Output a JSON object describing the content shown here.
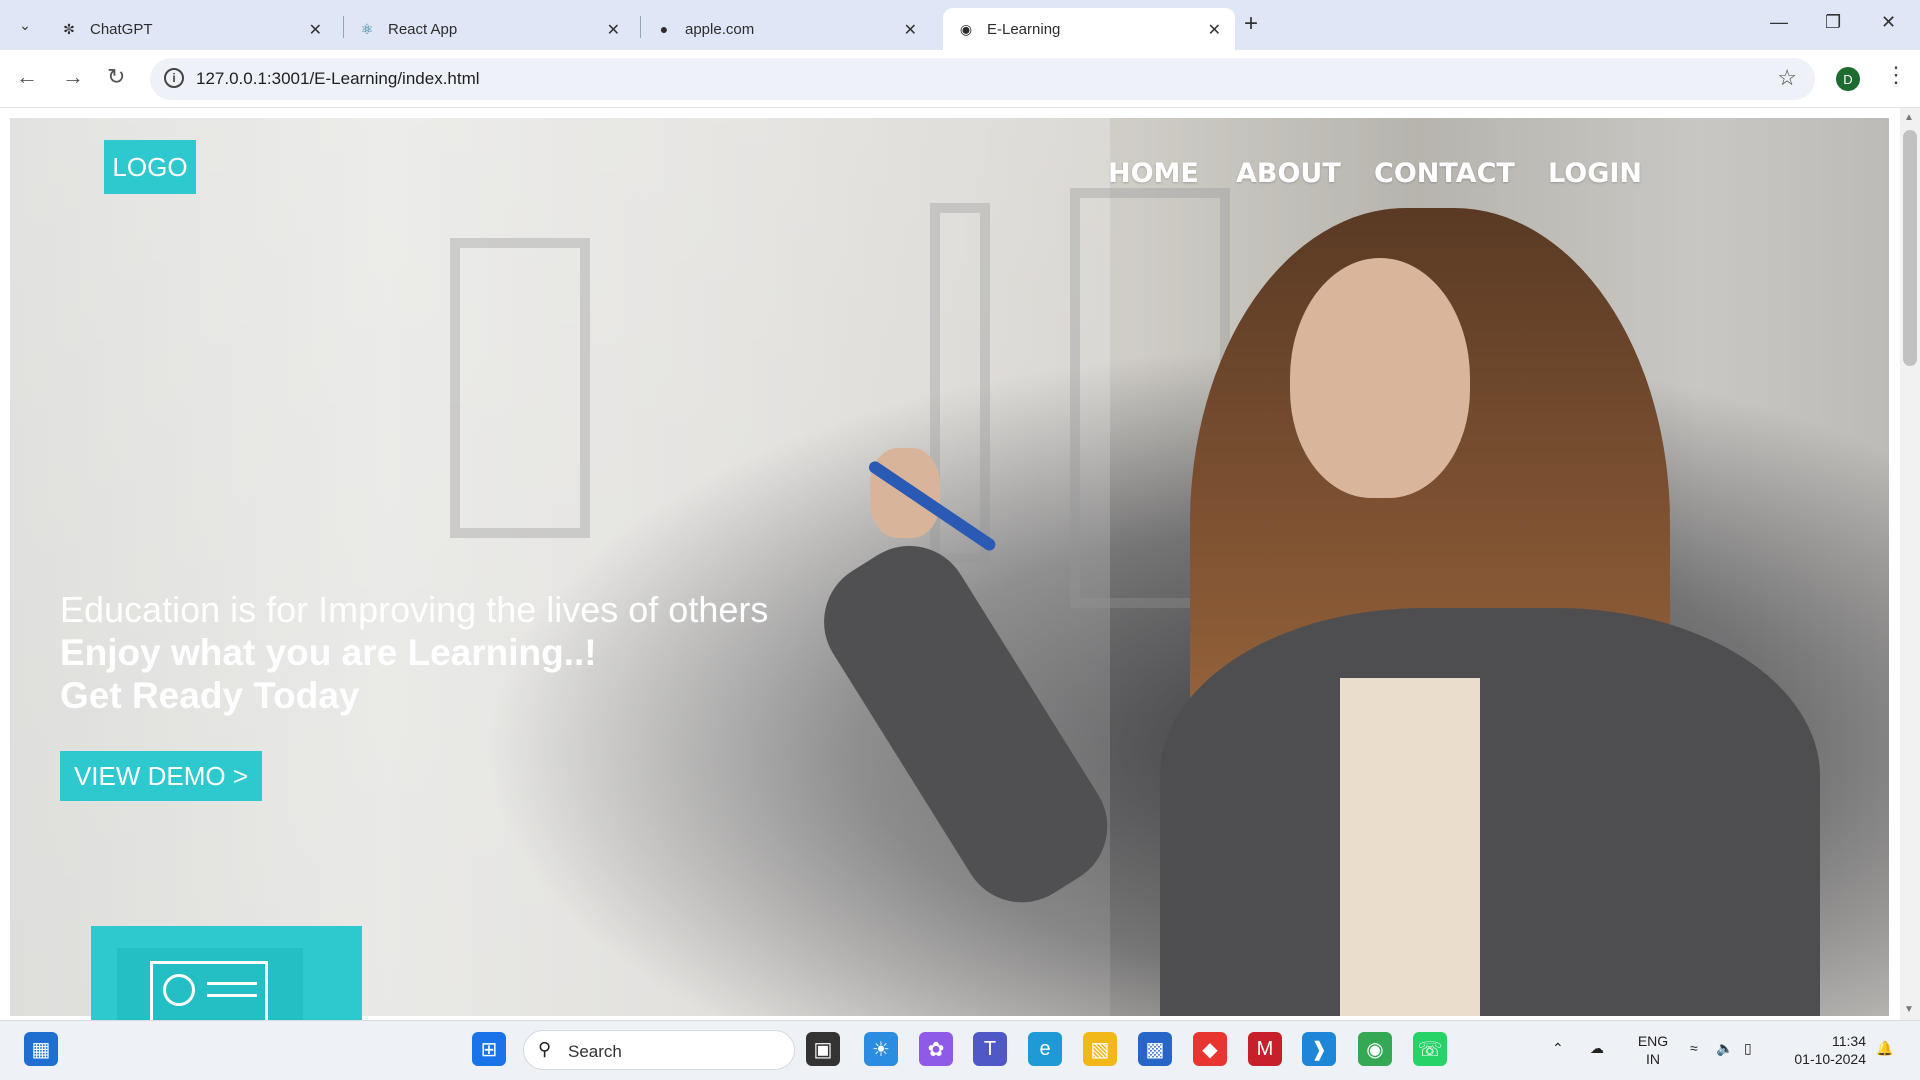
{
  "browser": {
    "tabs": [
      {
        "title": "ChatGPT",
        "icon": "chatgpt-icon"
      },
      {
        "title": "React App",
        "icon": "react-icon"
      },
      {
        "title": "apple.com",
        "icon": "apple-icon"
      },
      {
        "title": "E-Learning",
        "icon": "globe-icon",
        "active": true
      }
    ],
    "url": "127.0.0.1:3001/E-Learning/index.html",
    "profile_initial": "D"
  },
  "page": {
    "logo": "LOGO",
    "nav": [
      "HOME",
      "ABOUT",
      "CONTACT",
      "LOGIN"
    ],
    "hero": {
      "line1": "Education is for Improving the lives of others",
      "line2": "Enjoy what you are Learning..!",
      "line3": "Get Ready Today"
    },
    "cta": "VIEW DEMO >",
    "accent_color": "#2ec9cf"
  },
  "taskbar": {
    "search_label": "Search",
    "lang_top": "ENG",
    "lang_bottom": "IN",
    "time": "11:34",
    "date": "01-10-2024"
  }
}
